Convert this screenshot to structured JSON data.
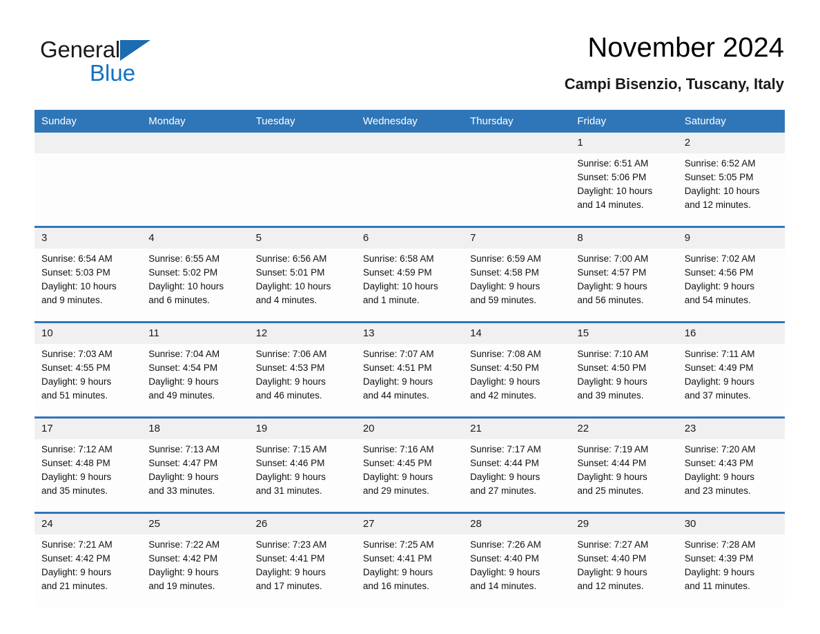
{
  "brand": {
    "word_general": "General",
    "word_blue": "Blue",
    "triangle_color": "#1b6cb0",
    "blue_color": "#1072c6"
  },
  "header": {
    "title": "November 2024",
    "subtitle": "Campi Bisenzio, Tuscany, Italy"
  },
  "theme": {
    "header_blue": "#2f76b8",
    "daynum_gray": "#f0f0f0",
    "cell_white": "#fdfdfd"
  },
  "calendar": {
    "weekday_headers": [
      "Sunday",
      "Monday",
      "Tuesday",
      "Wednesday",
      "Thursday",
      "Friday",
      "Saturday"
    ],
    "weeks": [
      [
        {
          "day": "",
          "sunrise": "",
          "sunset": "",
          "daylight_1": "",
          "daylight_2": ""
        },
        {
          "day": "",
          "sunrise": "",
          "sunset": "",
          "daylight_1": "",
          "daylight_2": ""
        },
        {
          "day": "",
          "sunrise": "",
          "sunset": "",
          "daylight_1": "",
          "daylight_2": ""
        },
        {
          "day": "",
          "sunrise": "",
          "sunset": "",
          "daylight_1": "",
          "daylight_2": ""
        },
        {
          "day": "",
          "sunrise": "",
          "sunset": "",
          "daylight_1": "",
          "daylight_2": ""
        },
        {
          "day": "1",
          "sunrise": "Sunrise: 6:51 AM",
          "sunset": "Sunset: 5:06 PM",
          "daylight_1": "Daylight: 10 hours",
          "daylight_2": "and 14 minutes."
        },
        {
          "day": "2",
          "sunrise": "Sunrise: 6:52 AM",
          "sunset": "Sunset: 5:05 PM",
          "daylight_1": "Daylight: 10 hours",
          "daylight_2": "and 12 minutes."
        }
      ],
      [
        {
          "day": "3",
          "sunrise": "Sunrise: 6:54 AM",
          "sunset": "Sunset: 5:03 PM",
          "daylight_1": "Daylight: 10 hours",
          "daylight_2": "and 9 minutes."
        },
        {
          "day": "4",
          "sunrise": "Sunrise: 6:55 AM",
          "sunset": "Sunset: 5:02 PM",
          "daylight_1": "Daylight: 10 hours",
          "daylight_2": "and 6 minutes."
        },
        {
          "day": "5",
          "sunrise": "Sunrise: 6:56 AM",
          "sunset": "Sunset: 5:01 PM",
          "daylight_1": "Daylight: 10 hours",
          "daylight_2": "and 4 minutes."
        },
        {
          "day": "6",
          "sunrise": "Sunrise: 6:58 AM",
          "sunset": "Sunset: 4:59 PM",
          "daylight_1": "Daylight: 10 hours",
          "daylight_2": "and 1 minute."
        },
        {
          "day": "7",
          "sunrise": "Sunrise: 6:59 AM",
          "sunset": "Sunset: 4:58 PM",
          "daylight_1": "Daylight: 9 hours",
          "daylight_2": "and 59 minutes."
        },
        {
          "day": "8",
          "sunrise": "Sunrise: 7:00 AM",
          "sunset": "Sunset: 4:57 PM",
          "daylight_1": "Daylight: 9 hours",
          "daylight_2": "and 56 minutes."
        },
        {
          "day": "9",
          "sunrise": "Sunrise: 7:02 AM",
          "sunset": "Sunset: 4:56 PM",
          "daylight_1": "Daylight: 9 hours",
          "daylight_2": "and 54 minutes."
        }
      ],
      [
        {
          "day": "10",
          "sunrise": "Sunrise: 7:03 AM",
          "sunset": "Sunset: 4:55 PM",
          "daylight_1": "Daylight: 9 hours",
          "daylight_2": "and 51 minutes."
        },
        {
          "day": "11",
          "sunrise": "Sunrise: 7:04 AM",
          "sunset": "Sunset: 4:54 PM",
          "daylight_1": "Daylight: 9 hours",
          "daylight_2": "and 49 minutes."
        },
        {
          "day": "12",
          "sunrise": "Sunrise: 7:06 AM",
          "sunset": "Sunset: 4:53 PM",
          "daylight_1": "Daylight: 9 hours",
          "daylight_2": "and 46 minutes."
        },
        {
          "day": "13",
          "sunrise": "Sunrise: 7:07 AM",
          "sunset": "Sunset: 4:51 PM",
          "daylight_1": "Daylight: 9 hours",
          "daylight_2": "and 44 minutes."
        },
        {
          "day": "14",
          "sunrise": "Sunrise: 7:08 AM",
          "sunset": "Sunset: 4:50 PM",
          "daylight_1": "Daylight: 9 hours",
          "daylight_2": "and 42 minutes."
        },
        {
          "day": "15",
          "sunrise": "Sunrise: 7:10 AM",
          "sunset": "Sunset: 4:50 PM",
          "daylight_1": "Daylight: 9 hours",
          "daylight_2": "and 39 minutes."
        },
        {
          "day": "16",
          "sunrise": "Sunrise: 7:11 AM",
          "sunset": "Sunset: 4:49 PM",
          "daylight_1": "Daylight: 9 hours",
          "daylight_2": "and 37 minutes."
        }
      ],
      [
        {
          "day": "17",
          "sunrise": "Sunrise: 7:12 AM",
          "sunset": "Sunset: 4:48 PM",
          "daylight_1": "Daylight: 9 hours",
          "daylight_2": "and 35 minutes."
        },
        {
          "day": "18",
          "sunrise": "Sunrise: 7:13 AM",
          "sunset": "Sunset: 4:47 PM",
          "daylight_1": "Daylight: 9 hours",
          "daylight_2": "and 33 minutes."
        },
        {
          "day": "19",
          "sunrise": "Sunrise: 7:15 AM",
          "sunset": "Sunset: 4:46 PM",
          "daylight_1": "Daylight: 9 hours",
          "daylight_2": "and 31 minutes."
        },
        {
          "day": "20",
          "sunrise": "Sunrise: 7:16 AM",
          "sunset": "Sunset: 4:45 PM",
          "daylight_1": "Daylight: 9 hours",
          "daylight_2": "and 29 minutes."
        },
        {
          "day": "21",
          "sunrise": "Sunrise: 7:17 AM",
          "sunset": "Sunset: 4:44 PM",
          "daylight_1": "Daylight: 9 hours",
          "daylight_2": "and 27 minutes."
        },
        {
          "day": "22",
          "sunrise": "Sunrise: 7:19 AM",
          "sunset": "Sunset: 4:44 PM",
          "daylight_1": "Daylight: 9 hours",
          "daylight_2": "and 25 minutes."
        },
        {
          "day": "23",
          "sunrise": "Sunrise: 7:20 AM",
          "sunset": "Sunset: 4:43 PM",
          "daylight_1": "Daylight: 9 hours",
          "daylight_2": "and 23 minutes."
        }
      ],
      [
        {
          "day": "24",
          "sunrise": "Sunrise: 7:21 AM",
          "sunset": "Sunset: 4:42 PM",
          "daylight_1": "Daylight: 9 hours",
          "daylight_2": "and 21 minutes."
        },
        {
          "day": "25",
          "sunrise": "Sunrise: 7:22 AM",
          "sunset": "Sunset: 4:42 PM",
          "daylight_1": "Daylight: 9 hours",
          "daylight_2": "and 19 minutes."
        },
        {
          "day": "26",
          "sunrise": "Sunrise: 7:23 AM",
          "sunset": "Sunset: 4:41 PM",
          "daylight_1": "Daylight: 9 hours",
          "daylight_2": "and 17 minutes."
        },
        {
          "day": "27",
          "sunrise": "Sunrise: 7:25 AM",
          "sunset": "Sunset: 4:41 PM",
          "daylight_1": "Daylight: 9 hours",
          "daylight_2": "and 16 minutes."
        },
        {
          "day": "28",
          "sunrise": "Sunrise: 7:26 AM",
          "sunset": "Sunset: 4:40 PM",
          "daylight_1": "Daylight: 9 hours",
          "daylight_2": "and 14 minutes."
        },
        {
          "day": "29",
          "sunrise": "Sunrise: 7:27 AM",
          "sunset": "Sunset: 4:40 PM",
          "daylight_1": "Daylight: 9 hours",
          "daylight_2": "and 12 minutes."
        },
        {
          "day": "30",
          "sunrise": "Sunrise: 7:28 AM",
          "sunset": "Sunset: 4:39 PM",
          "daylight_1": "Daylight: 9 hours",
          "daylight_2": "and 11 minutes."
        }
      ]
    ]
  }
}
